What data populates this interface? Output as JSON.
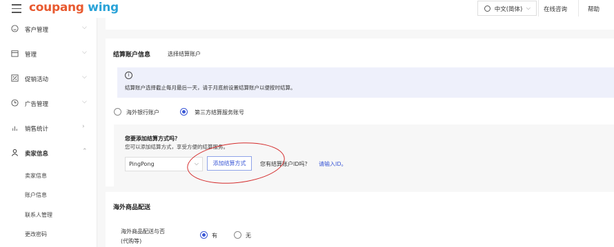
{
  "header": {
    "logo_part1": "coupang",
    "logo_part2": "wing",
    "language": "中文(简体)",
    "online_consult": "在线咨询",
    "help": "帮助"
  },
  "sidebar": {
    "items": [
      {
        "label": "客户管理",
        "icon": "smiley-icon"
      },
      {
        "label": "管理",
        "icon": "store-icon"
      },
      {
        "label": "促销活动",
        "icon": "percent-icon"
      },
      {
        "label": "广告管理",
        "icon": "clock-icon"
      },
      {
        "label": "销售统计",
        "icon": "bar-chart-icon"
      },
      {
        "label": "卖家信息",
        "icon": "person-icon"
      }
    ],
    "subitems": [
      "卖家信息",
      "账户信息",
      "联系人管理",
      "更改密码"
    ]
  },
  "settlement": {
    "title": "结算账户信息",
    "choose_link": "选择结算账户",
    "info_text": "结算账户选择截止每月最后一天，请于月底前设置结算账户以便按时结算。",
    "options": [
      "海外银行账户",
      "第三方结算服务账号"
    ],
    "selected_option": "第三方结算服务账号",
    "add_question": "您要添加结算方式吗？",
    "add_subtitle": "您可以添加结算方式，享受方便的结算服务。",
    "provider": "PingPong",
    "add_button": "添加结算方式",
    "has_id_question": "您有结算账户ID吗？",
    "enter_id_link": "请输入ID。"
  },
  "overseas_delivery": {
    "title": "海外商品配送",
    "question_line1": "海外商品配送与否",
    "question_line2": "(代购等)",
    "options": [
      "有",
      "无"
    ],
    "selected_option": "有"
  },
  "colors": {
    "accent": "#3a57d6",
    "info_bg": "#eef0fb",
    "annotation": "#d42b2b"
  }
}
